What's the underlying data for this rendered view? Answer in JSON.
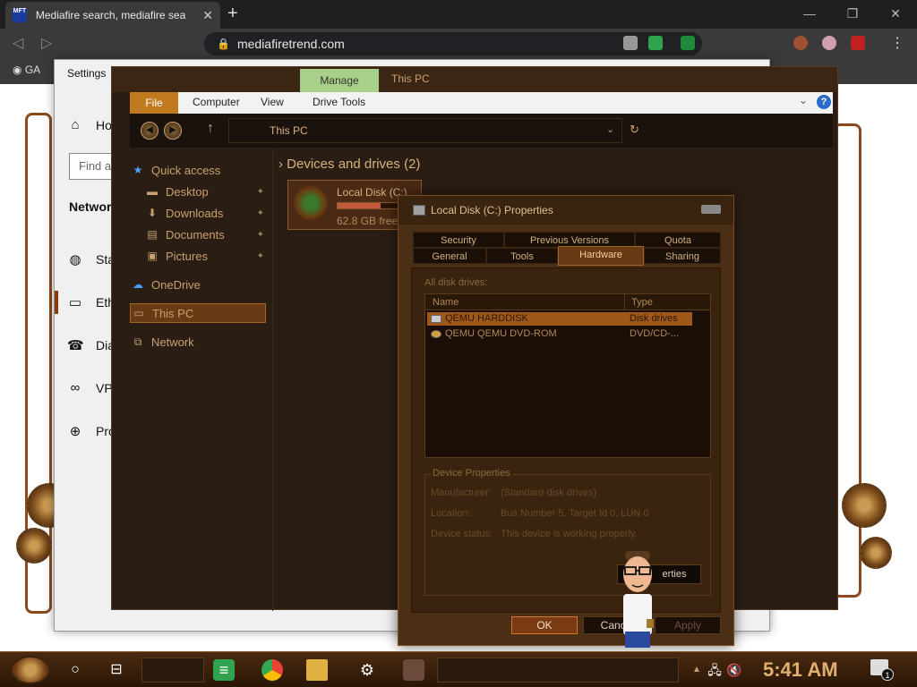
{
  "browser": {
    "tab_title": "Mediafire search, mediafire sea",
    "favicon_text": "MFT",
    "url": "mediafiretrend.com",
    "bookmark_label": "GA"
  },
  "settings": {
    "title": "Settings",
    "home_label": "Ho",
    "find_placeholder": "Find a",
    "section_title": "Network",
    "nav_items": [
      "Sta",
      "Ethe",
      "Dial",
      "VPN",
      "Prox"
    ]
  },
  "explorer": {
    "manage_tab": "Manage",
    "window_title": "This PC",
    "ribbon": {
      "file": "File",
      "computer": "Computer",
      "view": "View",
      "drive_tools": "Drive Tools"
    },
    "address_path": "This PC",
    "nav": {
      "quick_access": "Quick access",
      "desktop": "Desktop",
      "downloads": "Downloads",
      "documents": "Documents",
      "pictures": "Pictures",
      "onedrive": "OneDrive",
      "this_pc": "This PC",
      "network": "Network"
    },
    "group_title": "Devices and drives (2)",
    "drive_c": {
      "name": "Local Disk (C:)",
      "free": "62.8 GB free",
      "used_fraction": 0.55
    }
  },
  "props": {
    "title": "Local Disk (C:) Properties",
    "tabs_row1": [
      "Security",
      "Previous Versions",
      "Quota"
    ],
    "tabs_row2": [
      "General",
      "Tools",
      "Hardware",
      "Sharing"
    ],
    "active_tab": "Hardware",
    "list_caption": "All disk drives:",
    "columns": {
      "name": "Name",
      "type": "Type"
    },
    "drives": [
      {
        "name": "QEMU HARDDISK",
        "type": "Disk drives",
        "icon": "hdd-icon"
      },
      {
        "name": "QEMU QEMU DVD-ROM",
        "type": "DVD/CD-...",
        "icon": "cdrom-icon"
      }
    ],
    "device_properties_legend": "Device Properties",
    "manufacturer_label": "Manufacturer:",
    "manufacturer_value": "(Standard disk drives)",
    "location_label": "Location:",
    "location_value": "Bus Number 5, Target Id 0, LUN 0",
    "status_label": "Device status:",
    "status_value": "This device is working properly.",
    "properties_button": "Properties",
    "properties_button_visible": "erties",
    "ok": "OK",
    "cancel": "Cance",
    "apply": "Apply"
  },
  "taskbar": {
    "clock": "5:41 AM",
    "notification_count": "1"
  }
}
